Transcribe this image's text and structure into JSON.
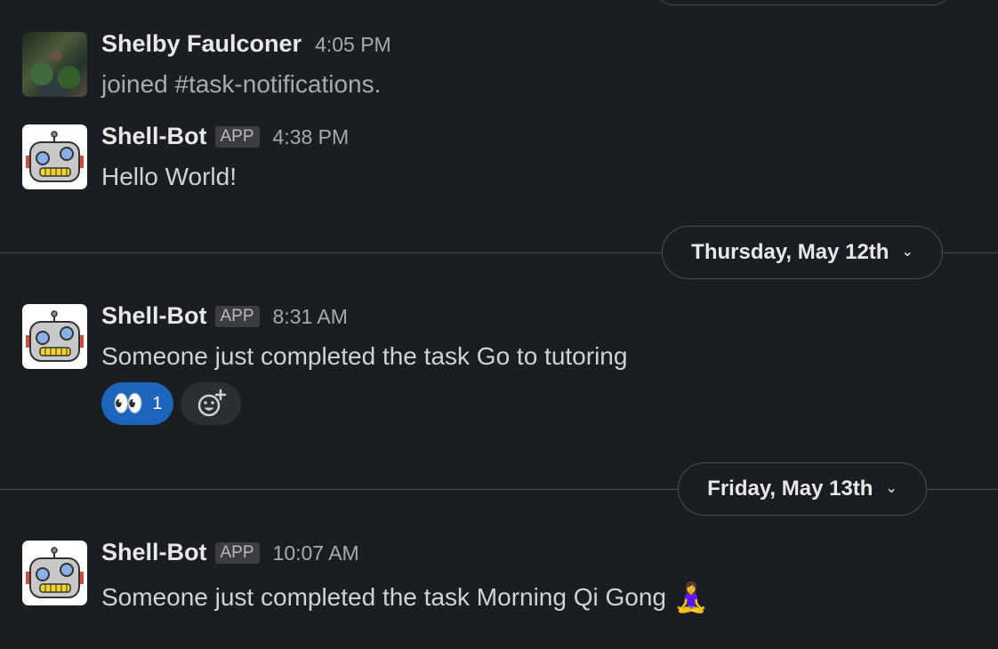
{
  "messages": [
    {
      "author": "Shelby Faulconer",
      "time": "4:05 PM",
      "text": "joined #task-notifications."
    },
    {
      "author": "Shell-Bot",
      "badge": "APP",
      "time": "4:38 PM",
      "text": "Hello World!"
    },
    {
      "author": "Shell-Bot",
      "badge": "APP",
      "time": "8:31 AM",
      "text": "Someone just completed the task Go to tutoring",
      "reaction": {
        "emoji": "👀",
        "count": "1"
      }
    },
    {
      "author": "Shell-Bot",
      "badge": "APP",
      "time": "10:07 AM",
      "text": "Someone just completed the task Morning Qi Gong",
      "emoji": "🧘‍♀️"
    }
  ],
  "dividers": [
    {
      "label": "Thursday, May 12th",
      "chevron": "⌄"
    },
    {
      "label": "Friday, May 13th",
      "chevron": "⌄"
    }
  ],
  "colors": {
    "background": "#1a1d21",
    "reaction_active": "#1d64bd",
    "divider_line": "#4a4d52"
  },
  "icons": {
    "add_reaction": "add-reaction-icon",
    "date_menu": "chevron-down-icon"
  }
}
